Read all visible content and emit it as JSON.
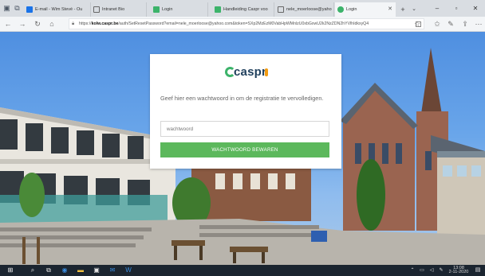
{
  "browser": {
    "tabs": [
      {
        "label": "E-mail - Wim Stevé - Ou",
        "color": "#1a73e8"
      },
      {
        "label": "Intranet Bio",
        "color": "#666666"
      },
      {
        "label": "Login",
        "color": "#3cb36a"
      },
      {
        "label": "Handleiding Caspr voo",
        "color": "#3cb36a"
      },
      {
        "label": "nele_moerloose@yaho",
        "color": "#666666"
      },
      {
        "label": "Login",
        "color": "#3cb36a",
        "active": true
      }
    ],
    "url": {
      "prefix": "https://",
      "host": "kolw.caspr.be",
      "path": "/auth/SetResetPassword?email=nele_moerloose@yahoo.com&token=SXp2MzEzM0VabHpWMnlzU0xbGxwU2k2NzZDN2hYVlhIdkxyQ4"
    }
  },
  "login": {
    "logo_text": "caspr",
    "message": "Geef hier een wachtwoord in om de registratie te vervolledigen.",
    "password_placeholder": "wachtwoord",
    "save_label": "WACHTWOORD BEWAREN"
  },
  "taskbar": {
    "time": "13:08",
    "date": "2-11-2020"
  },
  "colors": {
    "brand_green": "#5cb85c",
    "logo_navy": "#1f3f5c",
    "logo_orange": "#f39c12"
  }
}
